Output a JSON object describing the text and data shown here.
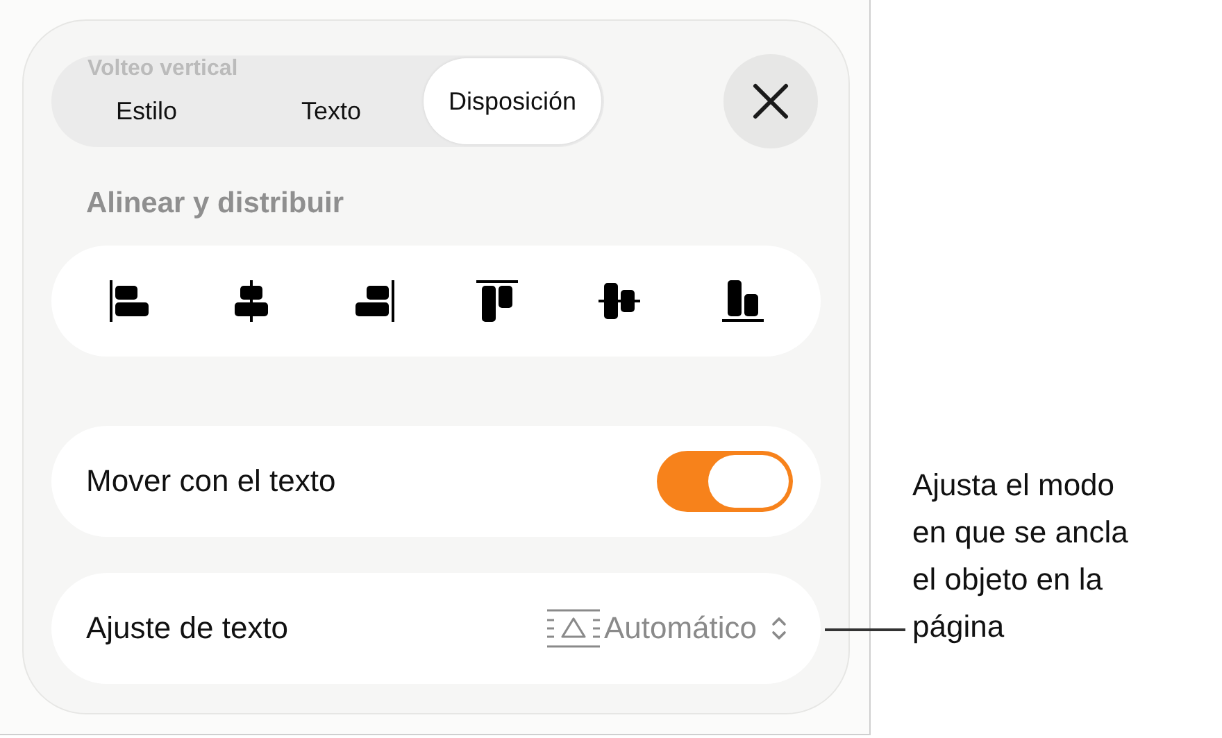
{
  "scrolled_heading": "Volteo vertical",
  "tabs": [
    {
      "label": "Estilo",
      "selected": false
    },
    {
      "label": "Texto",
      "selected": false
    },
    {
      "label": "Disposición",
      "selected": true
    }
  ],
  "section_title": "Alinear y distribuir",
  "align_buttons": [
    {
      "kind": "left"
    },
    {
      "kind": "center"
    },
    {
      "kind": "right"
    },
    {
      "kind": "top"
    },
    {
      "kind": "middle"
    },
    {
      "kind": "bottom"
    }
  ],
  "rows": [
    {
      "kind": "toggle",
      "label": "Mover con el texto",
      "on": true
    },
    {
      "kind": "popup",
      "label": "Ajuste de texto",
      "value": "Automático"
    }
  ],
  "callout": "Ajusta el modo en que se ancla el objeto en la página"
}
